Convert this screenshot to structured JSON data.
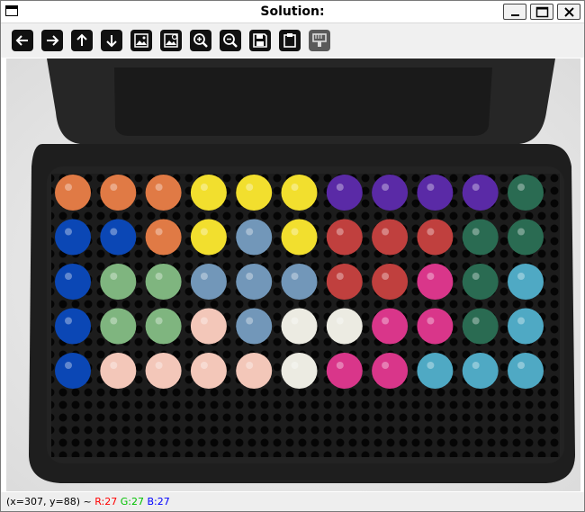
{
  "window": {
    "title": "Solution:"
  },
  "toolbar": {
    "buttons": [
      {
        "name": "pan-left-icon"
      },
      {
        "name": "pan-right-icon"
      },
      {
        "name": "pan-up-icon"
      },
      {
        "name": "pan-down-icon"
      },
      {
        "name": "zoom-fit-icon"
      },
      {
        "name": "zoom-original-icon"
      },
      {
        "name": "zoom-in-icon"
      },
      {
        "name": "zoom-out-icon"
      },
      {
        "name": "save-icon"
      },
      {
        "name": "copy-clipboard-icon"
      },
      {
        "name": "properties-icon"
      }
    ]
  },
  "status": {
    "coords": "(x=307, y=88) ~",
    "r": "R:27",
    "g": "G:27",
    "b": "B:27"
  },
  "puzzle": {
    "colors": {
      "O": "#e07a45",
      "Y": "#f2df2e",
      "V": "#5a2aa6",
      "D": "#2a6b52",
      "B": "#0b47b5",
      "S": "#7297b9",
      "R": "#c0403e",
      "G": "#7fb57f",
      "C": "#4fa9c4",
      "P": "#f3c7b9",
      "W": "#ecebe2",
      "M": "#d9368a"
    },
    "grid": [
      [
        "O",
        "O",
        "O",
        "Y",
        "Y",
        "Y",
        "V",
        "V",
        "V",
        "V",
        "D"
      ],
      [
        "B",
        "B",
        "O",
        "Y",
        "S",
        "Y",
        "R",
        "R",
        "R",
        "D",
        "D"
      ],
      [
        "B",
        "G",
        "G",
        "S",
        "S",
        "S",
        "R",
        "R",
        "M",
        "D",
        "C"
      ],
      [
        "B",
        "G",
        "G",
        "P",
        "S",
        "W",
        "W",
        "M",
        "M",
        "D",
        "C"
      ],
      [
        "B",
        "P",
        "P",
        "P",
        "P",
        "W",
        "M",
        "M",
        "C",
        "C",
        "C"
      ]
    ]
  }
}
